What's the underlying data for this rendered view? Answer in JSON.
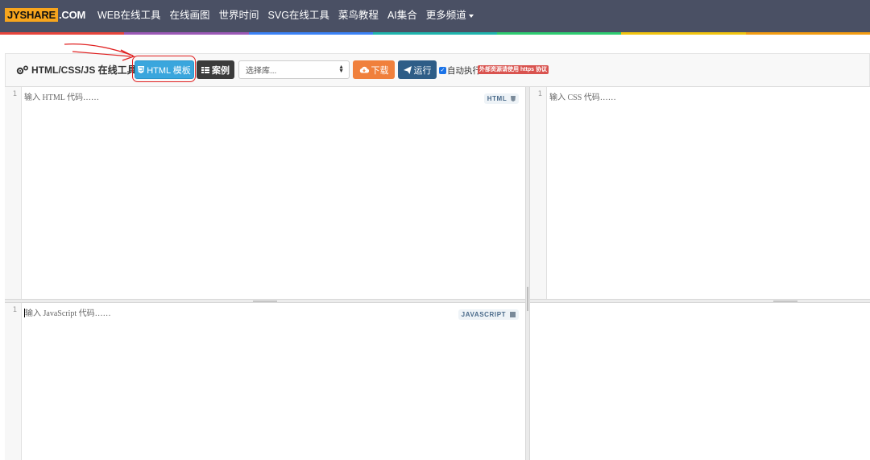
{
  "nav": {
    "logo_brand": "JYSHARE",
    "logo_suffix": ".COM",
    "items": [
      "WEB在线工具",
      "在线画图",
      "世界时间",
      "SVG在线工具",
      "菜鸟教程",
      "AI集合",
      "更多频道"
    ],
    "rainbow_colors": [
      "#e8453c",
      "#9b59b6",
      "#3b82f6",
      "#1fb5ad",
      "#2ecc71",
      "#f1c40f",
      "#f39c12"
    ]
  },
  "toolbar": {
    "title": "HTML/CSS/JS 在线工具",
    "title_icon": "gears-icon",
    "template_button": "HTML 模板",
    "cases_button": "案例",
    "library_select_placeholder": "选择库...",
    "download_button": "下载",
    "run_button": "运行",
    "auto_run_label": "自动执行",
    "auto_run_checked": true,
    "https_note": "外部资源请使用 https 协议"
  },
  "editors": {
    "html": {
      "line": "1",
      "placeholder": "输入 HTML 代码……",
      "tag": "HTML",
      "tag_icon": "html5-icon"
    },
    "css": {
      "line": "1",
      "placeholder": "输入 CSS 代码……"
    },
    "js": {
      "line": "1",
      "placeholder": "输入 JavaScript 代码……",
      "tag": "JAVASCRIPT",
      "tag_icon": "js-icon"
    }
  },
  "colors": {
    "navbar_bg": "#4a5064",
    "template_btn": "#3aa6dd",
    "download_btn": "#f0803c",
    "run_btn": "#2e5d87",
    "annotation_red": "#e02020"
  }
}
